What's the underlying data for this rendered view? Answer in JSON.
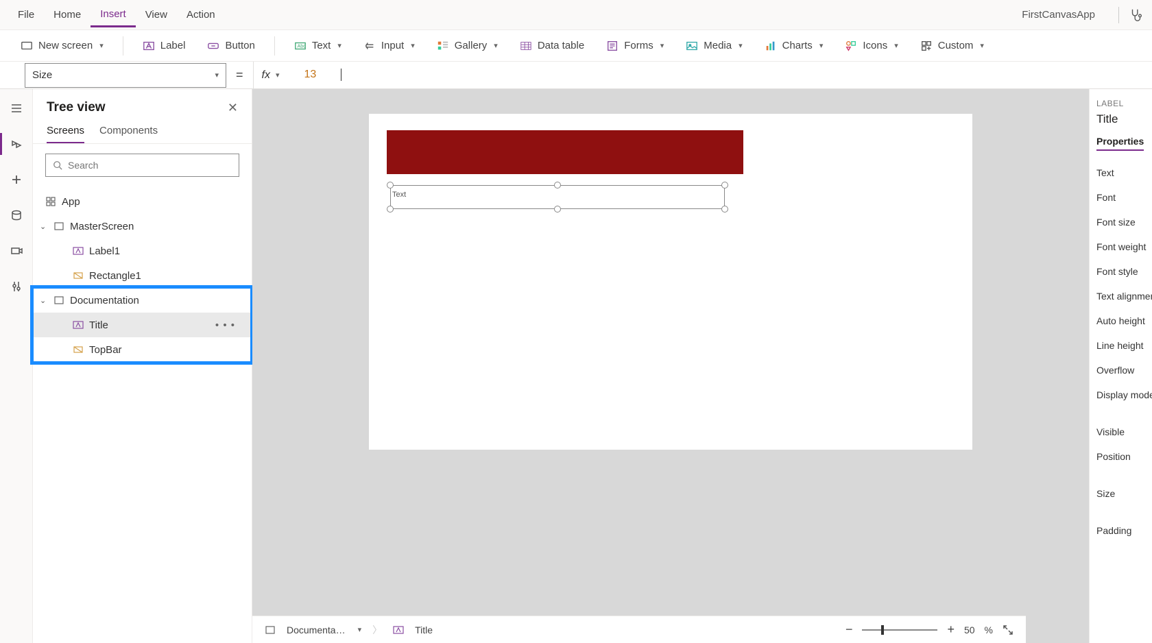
{
  "menubar": {
    "items": [
      "File",
      "Home",
      "Insert",
      "View",
      "Action"
    ],
    "active_index": 2,
    "app_name": "FirstCanvasApp"
  },
  "ribbon": {
    "new_screen": "New screen",
    "label": "Label",
    "button": "Button",
    "text": "Text",
    "input": "Input",
    "gallery": "Gallery",
    "data_table": "Data table",
    "forms": "Forms",
    "media": "Media",
    "charts": "Charts",
    "icons": "Icons",
    "custom": "Custom"
  },
  "formula": {
    "property": "Size",
    "value": "13"
  },
  "treeview": {
    "title": "Tree view",
    "tabs": [
      "Screens",
      "Components"
    ],
    "active_tab": 0,
    "search_placeholder": "Search",
    "app_label": "App",
    "nodes": {
      "master": "MasterScreen",
      "label1": "Label1",
      "rect1": "Rectangle1",
      "doc": "Documentation",
      "title": "Title",
      "topbar": "TopBar"
    }
  },
  "canvas": {
    "selected_text": "Text"
  },
  "rightpanel": {
    "type": "LABEL",
    "name": "Title",
    "tab": "Properties",
    "rows": [
      "Text",
      "Font",
      "Font size",
      "Font weight",
      "Font style",
      "Text alignment",
      "Auto height",
      "Line height",
      "Overflow",
      "Display mode",
      "Visible",
      "Position",
      "Size",
      "Padding"
    ]
  },
  "statusbar": {
    "crumb_screen": "Documenta…",
    "crumb_control": "Title",
    "zoom_value": "50",
    "zoom_unit": "%"
  }
}
